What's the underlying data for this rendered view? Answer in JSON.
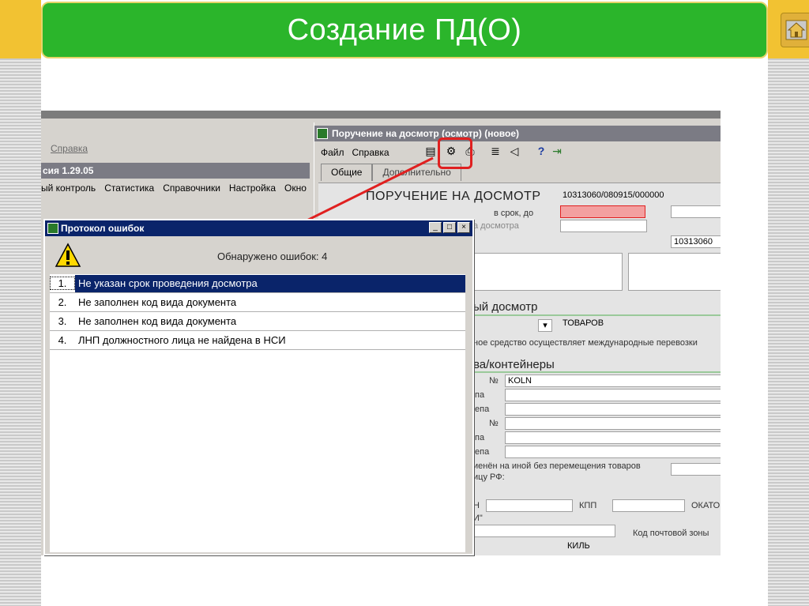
{
  "slide": {
    "title": "Создание ПД(О)"
  },
  "back_app": {
    "menu_item": "Справка",
    "version": "сия 1.29.05",
    "menu2": [
      "ый контроль",
      "Статистика",
      "Справочники",
      "Настройка",
      "Окно"
    ]
  },
  "main_window": {
    "title": "Поручение на досмотр (осмотр) (новое)",
    "menu": [
      "Файл",
      "Справка"
    ],
    "tabs": [
      "Общие",
      "Дополнительно"
    ],
    "form_title": "ПОРУЧЕНИЕ НА ДОСМОТР",
    "doc_number": "10313060/080915/000000",
    "deadline_label": "в срок, до",
    "inspection_label": "а досмотра",
    "customs_code": "10313060",
    "section_inspection": "ый досмотр",
    "goods_value": "ТОВАРОВ",
    "transport_text": "ное средство осуществляет международные перевозки",
    "section_containers": "ва/контейнеры",
    "no_label": "№",
    "no_label2": "№",
    "container_value": "KOLN",
    "pa_label": "па",
    "epa_label": "епа",
    "pa_label2": "па",
    "epa_label2": "епа",
    "replace_text": "иенён на иной без перемещения товаров",
    "border_text": "ицу РФ:",
    "n_label": "Н",
    "kpp_label": "КПП",
    "okato_label": "ОКАТО",
    "i_text": "И\"",
    "postal_label": "Код почтовой зоны",
    "city_value": "КИЛЬ"
  },
  "error_dialog": {
    "title": "Протокол ошибок",
    "count_text": "Обнаружено ошибок: 4",
    "errors": [
      {
        "num": "1.",
        "text": "Не указан срок проведения досмотра"
      },
      {
        "num": "2.",
        "text": "Не заполнен код вида документа"
      },
      {
        "num": "3.",
        "text": "Не заполнен код вида документа"
      },
      {
        "num": "4.",
        "text": "ЛНП должностного лица не найдена в НСИ"
      }
    ]
  },
  "colors": {
    "title_green": "#2bb52b",
    "accent_red": "#e02020",
    "dialog_title": "#0a246a"
  }
}
